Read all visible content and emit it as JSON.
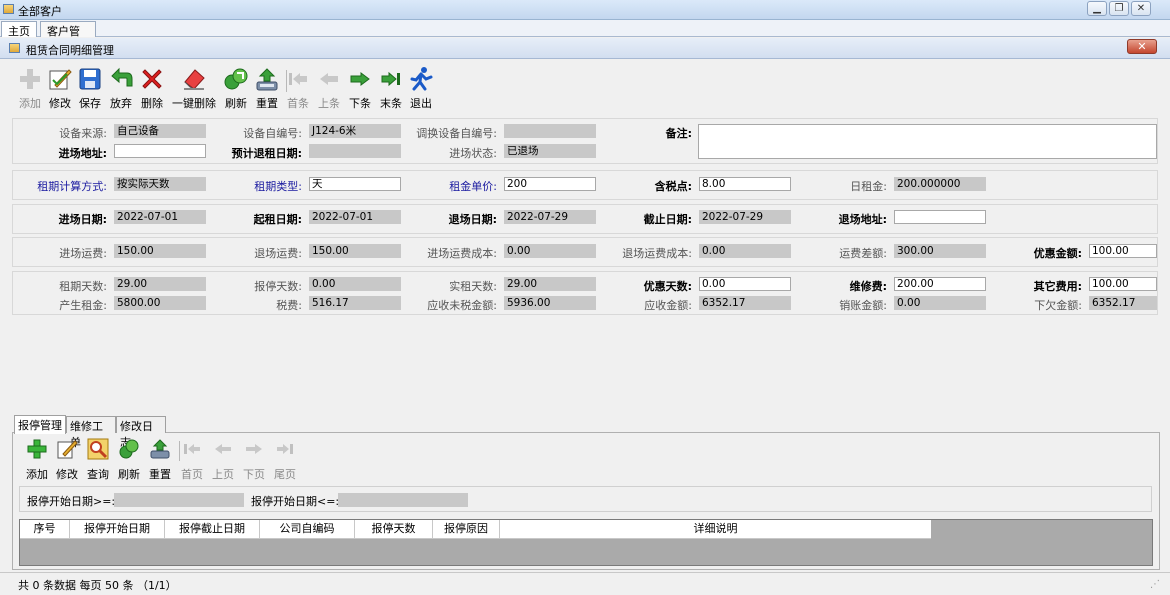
{
  "window": {
    "title": "全部客户"
  },
  "top_tabs": [
    "主页",
    "客户管理"
  ],
  "form_window": {
    "title": "租赁合同明细管理"
  },
  "toolbar": [
    {
      "label": "添加",
      "icon": "add-icon",
      "enabled": false
    },
    {
      "label": "修改",
      "icon": "edit-icon",
      "enabled": true
    },
    {
      "label": "保存",
      "icon": "save-icon",
      "enabled": true
    },
    {
      "label": "放弃",
      "icon": "undo-icon",
      "enabled": true
    },
    {
      "label": "删除",
      "icon": "delete-icon",
      "enabled": true
    },
    {
      "label": "一键删除",
      "icon": "eraser-icon",
      "enabled": true
    },
    {
      "label": "刷新",
      "icon": "refresh-icon",
      "enabled": true
    },
    {
      "label": "重置",
      "icon": "reset-icon",
      "enabled": true
    },
    {
      "label": "首条",
      "icon": "first-icon",
      "enabled": false
    },
    {
      "label": "上条",
      "icon": "prev-icon",
      "enabled": false
    },
    {
      "label": "下条",
      "icon": "next-icon",
      "enabled": true
    },
    {
      "label": "末条",
      "icon": "last-icon",
      "enabled": true
    },
    {
      "label": "退出",
      "icon": "exit-icon",
      "enabled": true
    }
  ],
  "fields": {
    "device_source": {
      "label": "设备来源:",
      "value": "自己设备"
    },
    "device_code": {
      "label": "设备自编号:",
      "value": "J124-6米"
    },
    "transfer_code": {
      "label": "调换设备自编号:",
      "value": ""
    },
    "remark": {
      "label": "备注:",
      "value": ""
    },
    "entry_address": {
      "label": "进场地址:",
      "value": ""
    },
    "planned_return": {
      "label": "预计退租日期:",
      "value": ""
    },
    "entry_status": {
      "label": "进场状态:",
      "value": "已退场"
    },
    "billing_method": {
      "label": "租期计算方式:",
      "value": "按实际天数"
    },
    "period_type": {
      "label": "租期类型:",
      "value": "天"
    },
    "unit_price": {
      "label": "租金单价:",
      "value": "200"
    },
    "tax_point": {
      "label": "含税点:",
      "value": "8.00"
    },
    "daily_rent": {
      "label": "日租金:",
      "value": "200.000000"
    },
    "entry_date": {
      "label": "进场日期:",
      "value": "2022-07-01"
    },
    "rent_start": {
      "label": "起租日期:",
      "value": "2022-07-01"
    },
    "exit_date": {
      "label": "退场日期:",
      "value": "2022-07-29"
    },
    "end_date": {
      "label": "截止日期:",
      "value": "2022-07-29"
    },
    "exit_address": {
      "label": "退场地址:",
      "value": ""
    },
    "entry_freight": {
      "label": "进场运费:",
      "value": "150.00"
    },
    "exit_freight": {
      "label": "退场运费:",
      "value": "150.00"
    },
    "entry_freight_cost": {
      "label": "进场运费成本:",
      "value": "0.00"
    },
    "exit_freight_cost": {
      "label": "退场运费成本:",
      "value": "0.00"
    },
    "freight_diff": {
      "label": "运费差额:",
      "value": "300.00"
    },
    "discount_amount": {
      "label": "优惠金额:",
      "value": "100.00"
    },
    "rent_days": {
      "label": "租期天数:",
      "value": "29.00"
    },
    "stop_days": {
      "label": "报停天数:",
      "value": "0.00"
    },
    "actual_days": {
      "label": "实租天数:",
      "value": "29.00"
    },
    "discount_days": {
      "label": "优惠天数:",
      "value": "0.00"
    },
    "repair_fee": {
      "label": "维修费:",
      "value": "200.00"
    },
    "other_fee": {
      "label": "其它费用:",
      "value": "100.00"
    },
    "rent_produced": {
      "label": "产生租金:",
      "value": "5800.00"
    },
    "tax_fee": {
      "label": "税费:",
      "value": "516.17"
    },
    "untaxed_receivable": {
      "label": "应收未税金额:",
      "value": "5936.00"
    },
    "receivable": {
      "label": "应收金额:",
      "value": "6352.17"
    },
    "written_off": {
      "label": "销账金额:",
      "value": "0.00"
    },
    "outstanding": {
      "label": "下欠金额:",
      "value": "6352.17"
    }
  },
  "bottom_tabs": [
    "报停管理",
    "维修工单",
    "修改日志"
  ],
  "sub_toolbar": [
    {
      "label": "添加",
      "icon": "add-icon",
      "enabled": true
    },
    {
      "label": "修改",
      "icon": "edit-icon",
      "enabled": true
    },
    {
      "label": "查询",
      "icon": "search-icon",
      "enabled": true
    },
    {
      "label": "刷新",
      "icon": "refresh-icon",
      "enabled": true
    },
    {
      "label": "重置",
      "icon": "reset-icon",
      "enabled": true
    },
    {
      "label": "首页",
      "icon": "first-icon",
      "enabled": false
    },
    {
      "label": "上页",
      "icon": "prev-icon",
      "enabled": false
    },
    {
      "label": "下页",
      "icon": "next-icon",
      "enabled": false
    },
    {
      "label": "尾页",
      "icon": "last-icon",
      "enabled": false
    }
  ],
  "filter": {
    "start_ge_label": "报停开始日期>=:",
    "start_ge_value": "",
    "start_le_label": "报停开始日期<=:",
    "start_le_value": ""
  },
  "grid": {
    "columns": [
      "序号",
      "报停开始日期",
      "报停截止日期",
      "公司自编码",
      "报停天数",
      "报停原因",
      "详细说明"
    ],
    "rows": []
  },
  "status": {
    "text": "共 0 条数据  每页 50 条 （1/1）"
  },
  "colors": {
    "accent_label": "#1a1aa0",
    "readonly_field": "#c8c8c8",
    "close_button": "#c4462e"
  }
}
